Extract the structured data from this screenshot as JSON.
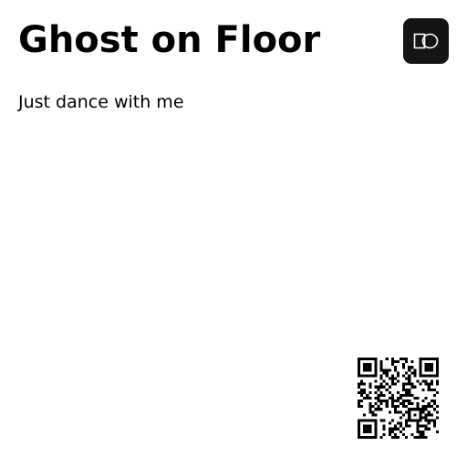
{
  "content": {
    "title": "Ghost on Floor",
    "subtitle": "Just dance with me"
  },
  "logo": {
    "icon": "device-logo-icon",
    "background_color": "#121416",
    "foreground_color": "#ffffff"
  },
  "qr_code": {
    "icon": "qr-code-icon",
    "color": "#000000"
  }
}
